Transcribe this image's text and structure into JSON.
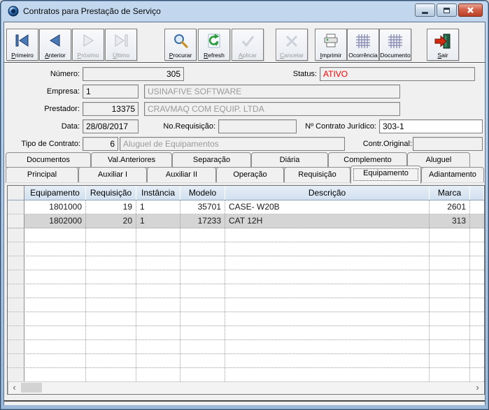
{
  "window": {
    "title": "Contratos para Prestação de Serviço"
  },
  "toolbar": {
    "buttons": [
      {
        "label": "Primeiro",
        "enabled": true,
        "icon": "first-record-icon"
      },
      {
        "label": "Anterior",
        "enabled": true,
        "icon": "previous-record-icon"
      },
      {
        "label": "Próximo",
        "enabled": false,
        "icon": "next-record-icon"
      },
      {
        "label": "Último",
        "enabled": false,
        "icon": "last-record-icon"
      },
      {
        "label": "Procurar",
        "enabled": true,
        "icon": "search-icon"
      },
      {
        "label": "Refresh",
        "enabled": true,
        "icon": "refresh-icon"
      },
      {
        "label": "Aplicar",
        "enabled": false,
        "icon": "apply-icon"
      },
      {
        "label": "Cancelar",
        "enabled": false,
        "icon": "cancel-icon"
      },
      {
        "label": "Imprimir",
        "enabled": true,
        "icon": "print-icon"
      },
      {
        "label": "Ocorrência",
        "enabled": true,
        "icon": "occurrence-grid-icon"
      },
      {
        "label": "Documento",
        "enabled": true,
        "icon": "document-grid-icon"
      },
      {
        "label": "Sair",
        "enabled": true,
        "icon": "exit-icon"
      }
    ]
  },
  "form": {
    "numero": {
      "label": "Número:",
      "value": "305"
    },
    "status": {
      "label": "Status:",
      "value": "ATIVO",
      "color": "#FF0000"
    },
    "empresa": {
      "label": "Empresa:",
      "code": "1",
      "name": "USINAFIVE SOFTWARE"
    },
    "prestador": {
      "label": "Prestador:",
      "code": "13375",
      "name": "CRAVMAQ COM EQUIP. LTDA"
    },
    "data": {
      "label": "Data:",
      "value": "28/08/2017"
    },
    "no_requisicao": {
      "label": "No.Requisição:",
      "value": ""
    },
    "contrato_juridico": {
      "label": "Nº Contrato Jurídico:",
      "value": "303-1"
    },
    "tipo_contrato": {
      "label": "Tipo de Contrato:",
      "code": "6",
      "name": "Aluguel de Equipamentos"
    },
    "contr_original": {
      "label": "Contr.Original:",
      "value": ""
    }
  },
  "tabs": {
    "row1": [
      "Documentos",
      "Val.Anteriores",
      "Separação",
      "Diária",
      "Complemento",
      "Aluguel"
    ],
    "row2": [
      "Principal",
      "Auxiliar I",
      "Auxiliar II",
      "Operação",
      "Requisição",
      "Equipamento",
      "Adiantamento"
    ],
    "selected": "Equipamento"
  },
  "grid": {
    "columns": [
      "Equipamento",
      "Requisição",
      "Instância",
      "Modelo",
      "Descrição",
      "Marca"
    ],
    "rows": [
      [
        "1801000",
        "19",
        "1",
        "35701",
        "CASE- W20B",
        "2601"
      ],
      [
        "1802000",
        "20",
        "1",
        "17233",
        "CAT 12H",
        "313"
      ]
    ],
    "hscrollbar": {
      "left_arrow": "‹",
      "right_arrow": "›"
    }
  },
  "colors": {
    "titlebar": "#B4CCE6",
    "status_red": "#FF0000",
    "grid_header": "#DBE6F2",
    "selected_row": "#D5D5D5"
  }
}
